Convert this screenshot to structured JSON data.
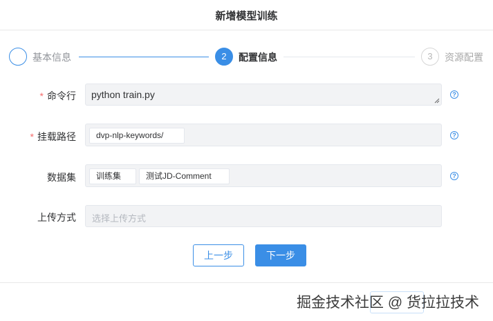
{
  "dialog": {
    "title": "新增模型训练"
  },
  "steps": [
    {
      "number": "",
      "label": "基本信息"
    },
    {
      "number": "2",
      "label": "配置信息"
    },
    {
      "number": "3",
      "label": "资源配置"
    }
  ],
  "form": {
    "command": {
      "label": "命令行",
      "value": "python train.py"
    },
    "mount_path": {
      "label": "挂载路径",
      "tags": [
        "dvp-nlp-keywords/"
      ]
    },
    "dataset": {
      "label": "数据集",
      "tags": [
        "训练集",
        "测试JD-Comment"
      ]
    },
    "upload": {
      "label": "上传方式",
      "placeholder": "选择上传方式"
    },
    "required_mark": "*",
    "help_glyph": "?"
  },
  "buttons": {
    "prev": "上一步",
    "next": "下一步"
  },
  "watermark": "掘金技术社区 @ 货拉拉技术",
  "colors": {
    "primary": "#3a8ee6",
    "required": "#f56c6c"
  }
}
